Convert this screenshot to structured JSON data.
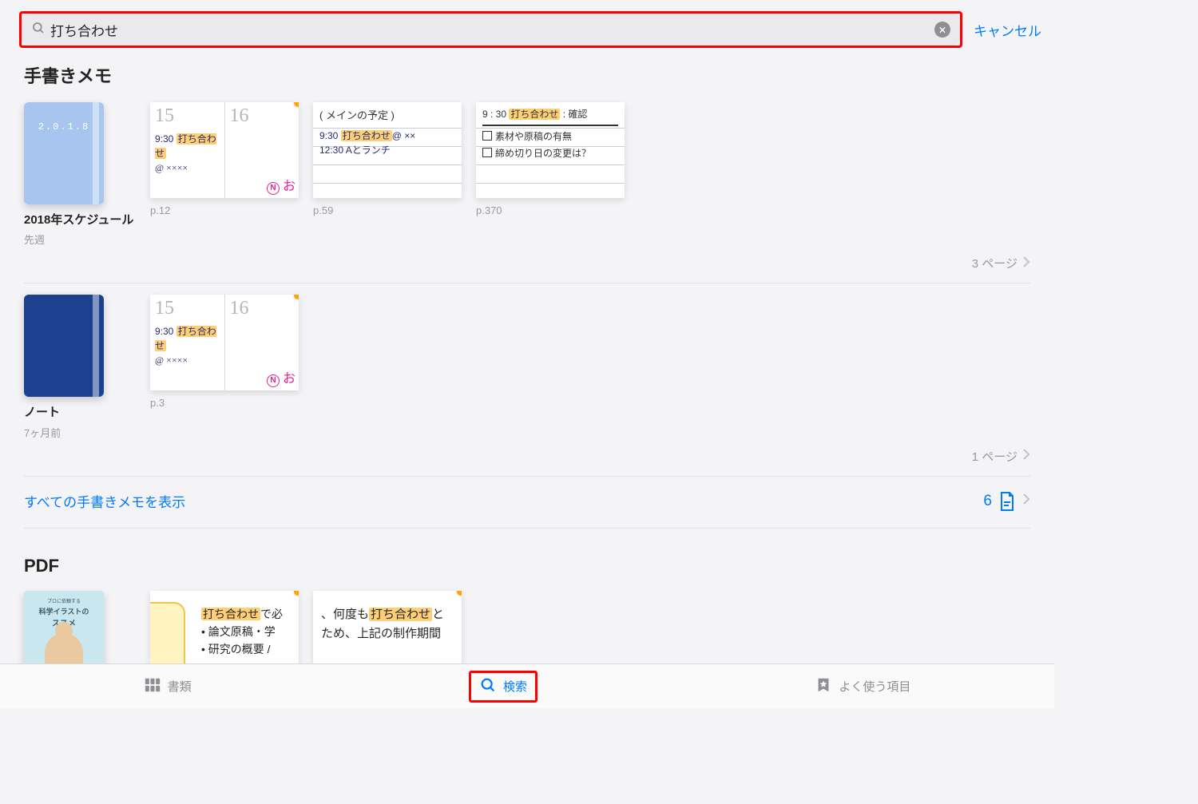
{
  "search": {
    "value": "打ち合わせ",
    "cancel": "キャンセル"
  },
  "sections": {
    "handwriting": {
      "title": "手書きメモ",
      "notebooks": [
        {
          "title": "2018年スケジュール",
          "sub": "先週",
          "cover_year": "2.0.1.8",
          "pages_label": "3 ページ",
          "pages": [
            {
              "label": "p.12",
              "d1": "15",
              "d2": "16",
              "l1": "9:30 ",
              "hl1": "打ち合わせ",
              "l2": "@ ××××",
              "pink": "お"
            },
            {
              "label": "p.59",
              "head": "( メインの予定 )",
              "l1": "9:30 ",
              "hl1": "打ち合わせ",
              "l1b": "@ ××",
              "l2": "12:30 Aとランチ"
            },
            {
              "label": "p.370",
              "l1": "9 : 30 ",
              "hl1": "打ち合わせ",
              "l1b": " : 確認",
              "c1": "素材や原稿の有無",
              "c2": "締め切り日の変更は？"
            }
          ]
        },
        {
          "title": "ノート",
          "sub": "7ヶ月前",
          "pages_label": "1 ページ",
          "pages": [
            {
              "label": "p.3",
              "d1": "15",
              "d2": "16",
              "l1": "9:30 ",
              "hl1": "打ち合わせ",
              "l2": "@ ××××",
              "pink": "お"
            }
          ]
        }
      ],
      "show_all": "すべての手書きメモを表示",
      "show_all_count": "6"
    },
    "pdf": {
      "title": "PDF",
      "cover": {
        "line1": "プロに依頼する",
        "line2": "科学イラストの",
        "line3": "ススメ"
      },
      "pages": [
        {
          "t1_pre": "",
          "t1_hl": "打ち合わせ",
          "t1_post": "で必",
          "t2": "論文原稿・学",
          "t3": "研究の概要 /"
        },
        {
          "t1_pre": "、何度も",
          "t1_hl": "打ち合わせ",
          "t1_post": "と",
          "t2": "ため、上記の制作期間"
        }
      ]
    }
  },
  "tabs": {
    "docs": "書類",
    "search": "検索",
    "fav": "よく使う項目"
  }
}
